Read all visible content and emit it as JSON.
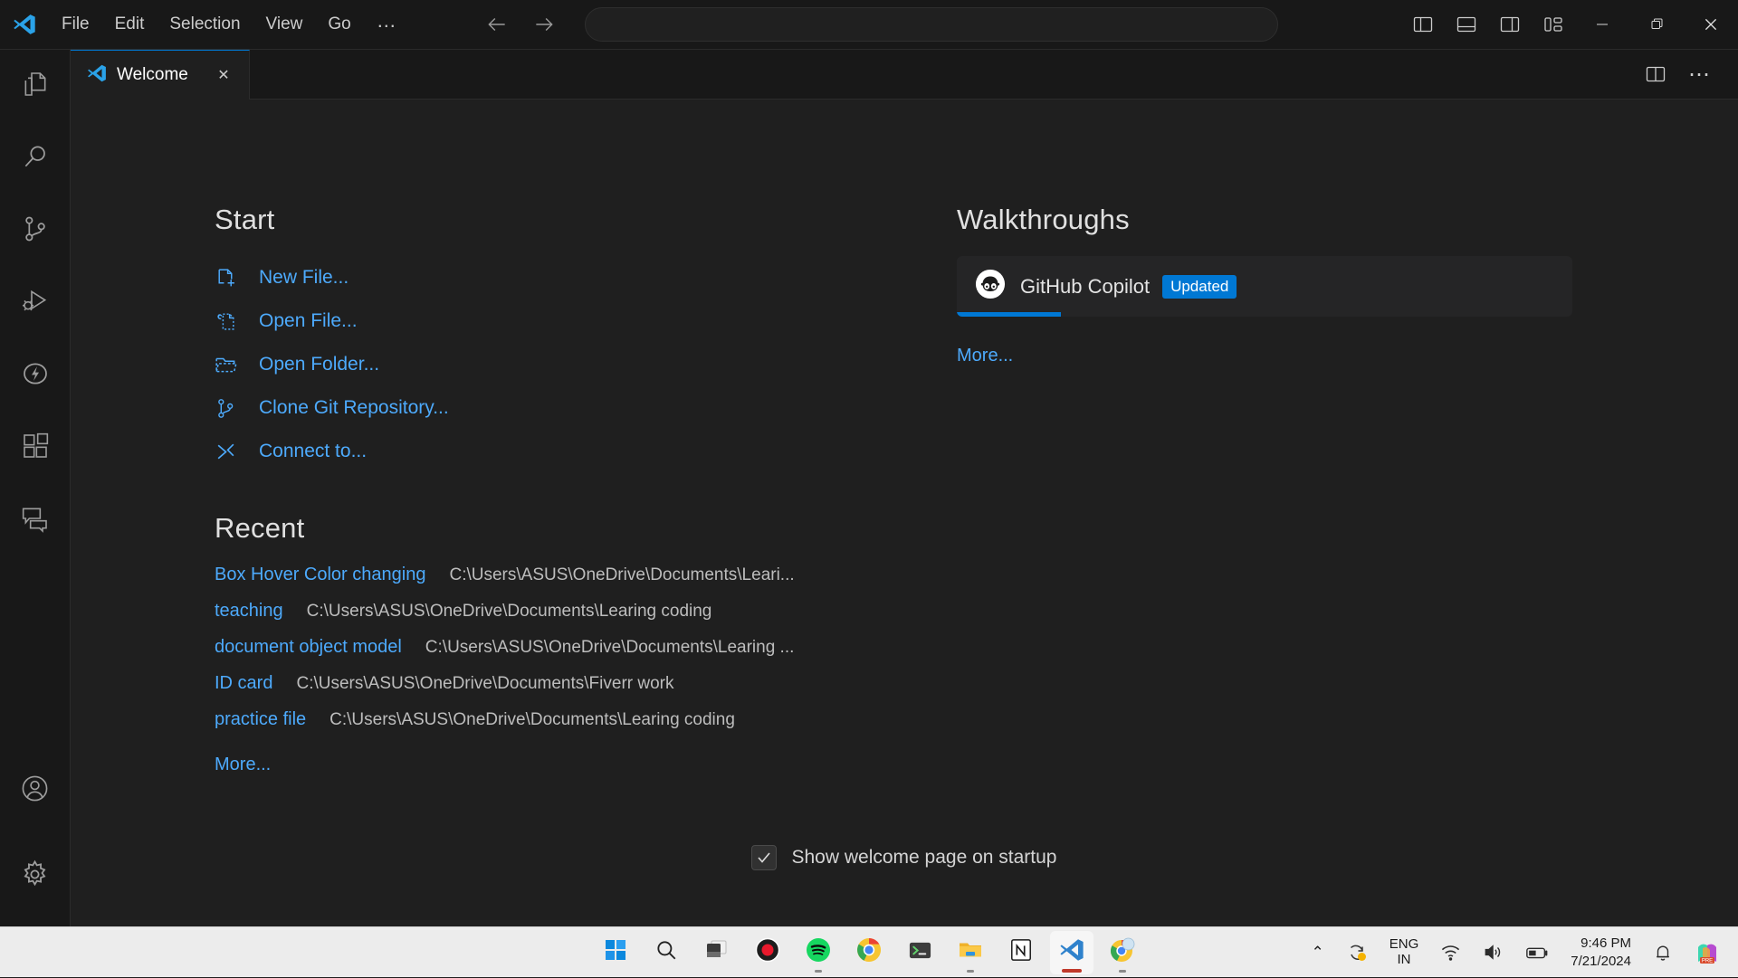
{
  "titlebar": {
    "logo_icon": "vscode-logo-icon",
    "menus": [
      {
        "label": "File"
      },
      {
        "label": "Edit"
      },
      {
        "label": "Selection"
      },
      {
        "label": "View"
      },
      {
        "label": "Go"
      }
    ],
    "overflow_label": "…",
    "nav": {
      "back_icon": "arrow-left-icon",
      "forward_icon": "arrow-right-icon"
    },
    "command_center": {
      "value": "",
      "placeholder": ""
    },
    "layout_buttons": [
      {
        "name": "toggle-primary-sidebar-icon"
      },
      {
        "name": "toggle-panel-icon"
      },
      {
        "name": "toggle-secondary-sidebar-icon"
      },
      {
        "name": "customize-layout-icon"
      }
    ],
    "window_controls": [
      {
        "name": "minimize-button",
        "glyph": "─"
      },
      {
        "name": "maximize-button",
        "glyph": "❐"
      },
      {
        "name": "close-button",
        "glyph": "✕"
      }
    ]
  },
  "activitybar": {
    "items": [
      {
        "name": "explorer",
        "icon": "files-icon"
      },
      {
        "name": "search",
        "icon": "search-icon"
      },
      {
        "name": "source-control",
        "icon": "source-control-icon"
      },
      {
        "name": "run-and-debug",
        "icon": "run-debug-icon"
      },
      {
        "name": "testing",
        "icon": "lightning-icon"
      },
      {
        "name": "extensions",
        "icon": "extensions-icon"
      },
      {
        "name": "chat",
        "icon": "comment-discussion-icon"
      }
    ],
    "bottom_items": [
      {
        "name": "accounts",
        "icon": "account-icon"
      },
      {
        "name": "manage-settings",
        "icon": "gear-icon"
      }
    ]
  },
  "tabbar": {
    "tabs": [
      {
        "label": "Welcome",
        "icon": "vscode-logo-icon",
        "active": true,
        "close_glyph": "✕"
      }
    ],
    "actions": [
      {
        "name": "split-editor-right-icon"
      },
      {
        "name": "more-actions-icon",
        "glyph": "⋯"
      }
    ]
  },
  "welcome": {
    "start": {
      "title": "Start",
      "links": [
        {
          "label": "New File...",
          "icon": "new-file-icon"
        },
        {
          "label": "Open File...",
          "icon": "go-to-file-icon"
        },
        {
          "label": "Open Folder...",
          "icon": "folder-opened-icon"
        },
        {
          "label": "Clone Git Repository...",
          "icon": "source-control-icon"
        },
        {
          "label": "Connect to...",
          "icon": "remote-explorer-icon"
        }
      ]
    },
    "recent": {
      "title": "Recent",
      "entries": [
        {
          "name": "Box Hover Color changing",
          "path": "C:\\Users\\ASUS\\OneDrive\\Documents\\Leari..."
        },
        {
          "name": "teaching",
          "path": "C:\\Users\\ASUS\\OneDrive\\Documents\\Learing coding"
        },
        {
          "name": "document object model",
          "path": "C:\\Users\\ASUS\\OneDrive\\Documents\\Learing ..."
        },
        {
          "name": "ID card",
          "path": "C:\\Users\\ASUS\\OneDrive\\Documents\\Fiverr work"
        },
        {
          "name": "practice file",
          "path": "C:\\Users\\ASUS\\OneDrive\\Documents\\Learing coding"
        }
      ],
      "more_label": "More..."
    },
    "walkthroughs": {
      "title": "Walkthroughs",
      "cards": [
        {
          "title": "GitHub Copilot",
          "badge": "Updated",
          "icon": "copilot-avatar-icon",
          "progress_percent": 17
        }
      ],
      "more_label": "More..."
    },
    "startup": {
      "label": "Show welcome page on startup",
      "checked": true,
      "check_glyph": "✓"
    }
  },
  "taskbar": {
    "apps": [
      {
        "name": "start-button",
        "icon": "windows-logo-icon"
      },
      {
        "name": "search-taskbar",
        "icon": "search-icon"
      },
      {
        "name": "task-view",
        "icon": "task-view-icon"
      },
      {
        "name": "screen-recorder",
        "icon": "record-icon"
      },
      {
        "name": "spotify",
        "icon": "spotify-icon",
        "running": true
      },
      {
        "name": "google-chrome",
        "icon": "chrome-icon"
      },
      {
        "name": "windows-terminal",
        "icon": "terminal-icon"
      },
      {
        "name": "file-explorer",
        "icon": "folder-icon",
        "running": true
      },
      {
        "name": "notion",
        "icon": "notion-icon"
      },
      {
        "name": "visual-studio-code",
        "icon": "vscode-logo-icon",
        "active": true
      },
      {
        "name": "chrome-app",
        "icon": "chrome-icon",
        "running": true
      }
    ],
    "tray": {
      "overflow_glyph": "⌃",
      "onedrive_icon": "onedrive-sync-icon",
      "language": "ENG\nIN",
      "language_line1": "ENG",
      "language_line2": "IN",
      "wifi_icon": "wifi-icon",
      "volume_icon": "volume-icon",
      "battery_icon": "battery-icon",
      "time": "9:46 PM",
      "date": "7/21/2024",
      "notifications_icon": "bell-icon",
      "app_icon": "office-pre-icon"
    }
  },
  "colors": {
    "accent": "#0078d4",
    "link": "#4daafc",
    "editor_bg": "#1f1f1f",
    "chrome_bg": "#181818",
    "taskbar_bg": "#ececec"
  }
}
